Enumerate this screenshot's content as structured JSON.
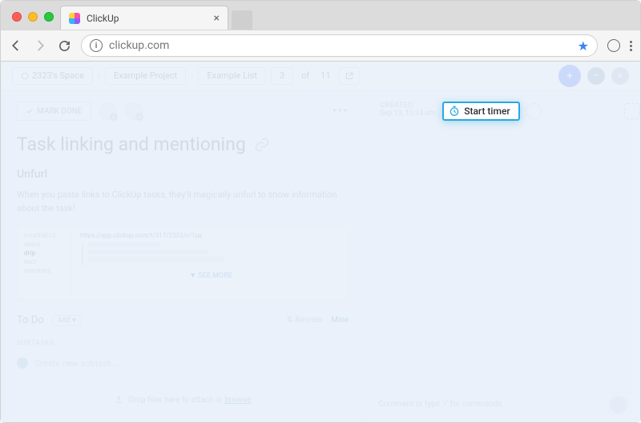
{
  "browser": {
    "tab_title": "ClickUp",
    "url": "clickup.com"
  },
  "crumbs": {
    "space": "2323's Space",
    "project": "Example Project",
    "list": "Example List",
    "index": "3",
    "of_label": "of",
    "total": "11"
  },
  "task": {
    "mark_done": "MARK DONE",
    "title": "Task linking and mentioning",
    "section_heading": "Unfurl",
    "body": "When you paste links to ClickUp tasks, they'll magically unfurl to show information about the task!",
    "embed_channels_heading": "CHANNELS",
    "embed_channels": [
      "about",
      "drip",
      "hect",
      "members"
    ],
    "embed_link": "https://app.clickup.com/t/317/2323/c/1ux",
    "embed_see_more": "▼ SEE MORE",
    "todo_label": "To Do",
    "add_label": "Add ▾",
    "reorder_label": "⇅ Reorder",
    "mine_label": "Mine",
    "subtasks_label": "SUBTASKS",
    "new_subtask_placeholder": "Create new subtask...",
    "dropzone_pre": "Drop files here to attach or ",
    "dropzone_link": "browse"
  },
  "meta": {
    "created_label": "CREATED",
    "created_value": "Sep 13, 10:34 am",
    "start_timer": "Start timer"
  },
  "comment": {
    "placeholder": "Comment or type '/' for commands"
  }
}
